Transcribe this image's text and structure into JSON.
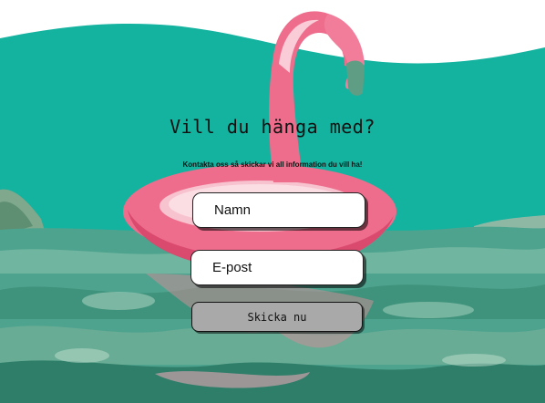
{
  "hero": {
    "heading": "Vill du hänga med?",
    "subheading": "Kontakta oss så skickar vi all information du vill ha!"
  },
  "form": {
    "name_placeholder": "Namn",
    "email_placeholder": "E-post",
    "submit_label": "Skicka nu"
  },
  "colors": {
    "teal": "#13b3a0",
    "water": "#4ea38f",
    "flamingo_pink": "#ee6d8c",
    "button_gray": "#a9a9a9"
  }
}
